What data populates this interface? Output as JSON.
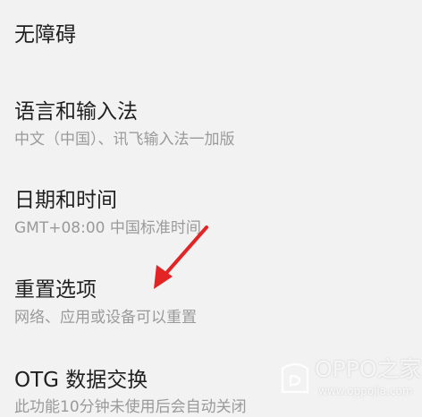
{
  "settings": {
    "items": [
      {
        "title": "无障碍",
        "subtitle": ""
      },
      {
        "title": "语言和输入法",
        "subtitle": "中文（中国）、讯飞输入法一加版"
      },
      {
        "title": "日期和时间",
        "subtitle": "GMT+08:00 中国标准时间"
      },
      {
        "title": "重置选项",
        "subtitle": "网络、应用或设备可以重置"
      },
      {
        "title": "OTG 数据交换",
        "subtitle": "此功能10分钟未使用后会自动关闭"
      }
    ]
  },
  "annotation": {
    "arrow_color": "#e32424"
  },
  "watermark": {
    "brand": "OPPO之家",
    "url": "www.oppojia.com"
  }
}
